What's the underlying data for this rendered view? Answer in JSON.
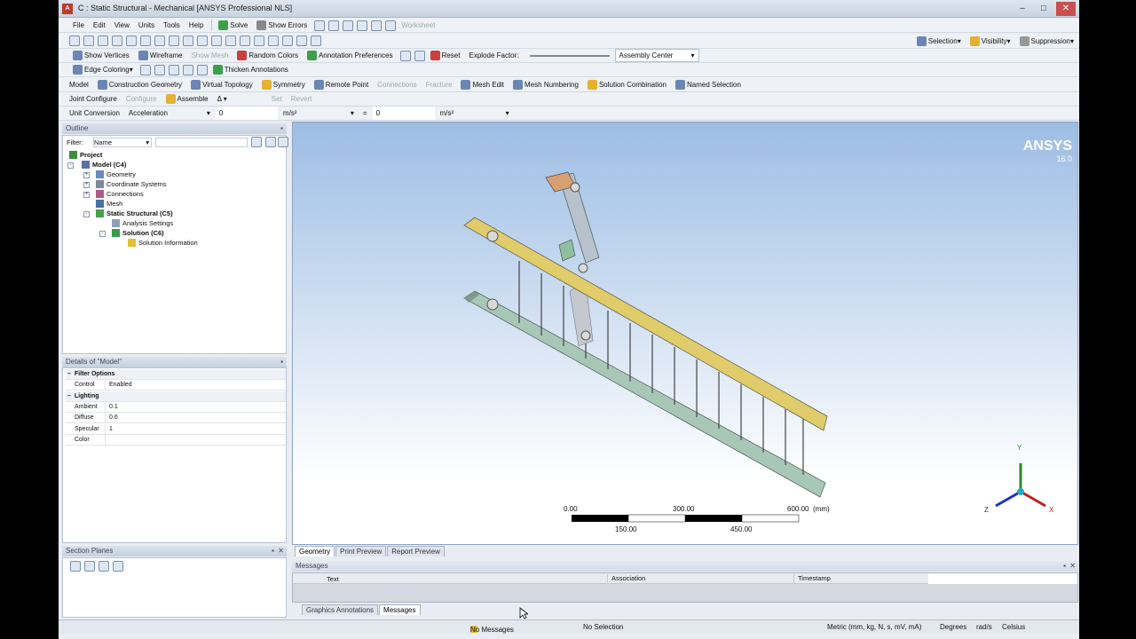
{
  "window": {
    "title": "C : Static Structural - Mechanical [ANSYS Professional NLS]",
    "app_icon": "A"
  },
  "menu": [
    "File",
    "Edit",
    "View",
    "Units",
    "Tools",
    "Help"
  ],
  "toolbar1": {
    "solve": "Solve",
    "show_errors": "Show Errors",
    "worksheet": "Worksheet",
    "selection": "Selection",
    "visibility": "Visibility",
    "suppression": "Suppression"
  },
  "toolbar2": {
    "show_vertices": "Show Vertices",
    "wireframe": "Wireframe",
    "show_mesh": "Show Mesh",
    "random_colors": "Random Colors",
    "annotation_preferences": "Annotation Preferences",
    "reset": "Reset",
    "explode_factor": "Explode Factor:",
    "assembly_center": "Assembly Center"
  },
  "toolbar3": {
    "edge_coloring": "Edge Coloring",
    "thicken_annotations": "Thicken Annotations"
  },
  "context_toolbar": {
    "model": "Model",
    "construction_geometry": "Construction Geometry",
    "virtual_topology": "Virtual Topology",
    "symmetry": "Symmetry",
    "remote_point": "Remote Point",
    "connections": "Connections",
    "fracture": "Fracture",
    "mesh_edit": "Mesh Edit",
    "mesh_numbering": "Mesh Numbering",
    "solution_combination": "Solution Combination",
    "named_selection": "Named Selection"
  },
  "joint_toolbar": {
    "joint_configure": "Joint Configure",
    "configure": "Configure",
    "assemble": "Assemble",
    "set": "Set",
    "revert": "Revert"
  },
  "unit_conversion": {
    "label": "Unit Conversion",
    "quantity": "Acceleration",
    "value1": "0",
    "unit1": "m/s²",
    "equals": "=",
    "value2": "0",
    "unit2": "m/s²"
  },
  "outline": {
    "header": "Outline",
    "filter_label": "Filter:",
    "filter_value": "Name",
    "tree": [
      {
        "label": "Project",
        "bold": true
      },
      {
        "label": "Model (C4)",
        "bold": true
      },
      {
        "label": "Geometry"
      },
      {
        "label": "Coordinate Systems"
      },
      {
        "label": "Connections"
      },
      {
        "label": "Mesh"
      },
      {
        "label": "Static Structural (C5)",
        "bold": true
      },
      {
        "label": "Analysis Settings"
      },
      {
        "label": "Solution (C6)",
        "bold": true
      },
      {
        "label": "Solution Information"
      }
    ]
  },
  "details": {
    "header": "Details of \"Model\"",
    "filter_options": "Filter Options",
    "control_label": "Control",
    "control_value": "Enabled",
    "lighting": "Lighting",
    "rows": [
      {
        "k": "Ambient",
        "v": "0.1"
      },
      {
        "k": "Diffuse",
        "v": "0.6"
      },
      {
        "k": "Specular",
        "v": "1"
      },
      {
        "k": "Color",
        "v": ""
      }
    ]
  },
  "section_planes": {
    "header": "Section Planes"
  },
  "viewport": {
    "brand": "ANSYS",
    "version": "16.0",
    "scale_unit": "(mm)",
    "scale_top": [
      "0.00",
      "300.00",
      "600.00"
    ],
    "scale_bottom": [
      "150.00",
      "450.00"
    ],
    "axis_x": "X",
    "axis_y": "Y",
    "axis_z": "Z"
  },
  "view_tabs": [
    "Geometry",
    "Print Preview",
    "Report Preview"
  ],
  "messages": {
    "header": "Messages",
    "col_text": "Text",
    "col_assoc": "Association",
    "col_time": "Timestamp"
  },
  "bottom_tabs": [
    "Graphics Annotations",
    "Messages"
  ],
  "status": {
    "messages": "No Messages",
    "selection": "No Selection",
    "units": "Metric (mm, kg, N, s, mV, mA)",
    "angle": "Degrees",
    "rate": "rad/s",
    "temp": "Celsius"
  }
}
